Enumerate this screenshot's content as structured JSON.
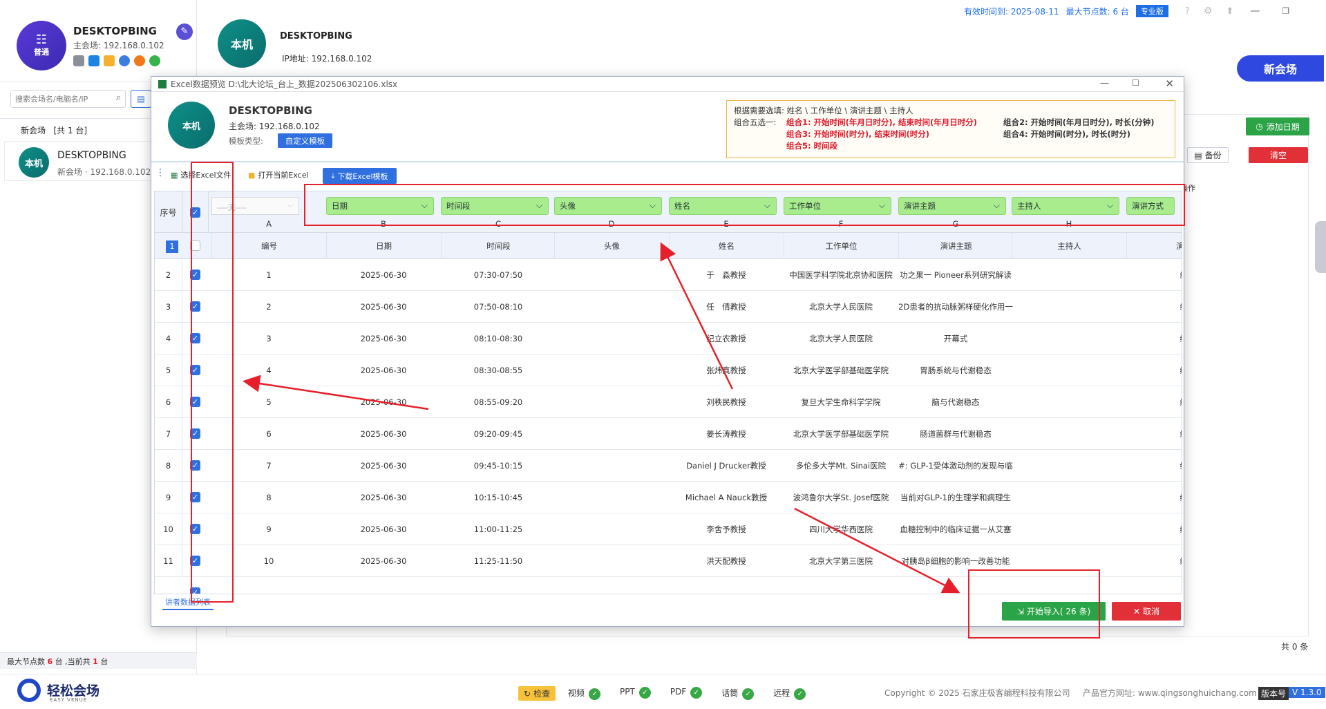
{
  "topbar": {
    "validity": "有效时间到: 2025-08-11",
    "max_nodes": "最大节点数: 6 台",
    "edition": "专业版"
  },
  "sidebar": {
    "host_badge": "普通",
    "host_name": "DESKTOPBING",
    "host_ip": "主会场: 192.168.0.102",
    "search_placeholder": "搜索会场名/电脑名/IP",
    "group_title": "新会场",
    "group_count": "[共 1 台]",
    "device_avatar": "本机",
    "device_name": "DESKTOPBING",
    "device_sub": "新会场 · 192.168.0.102",
    "footer": {
      "prefix": "最大节点数",
      "max": "6",
      "mid": "台 ,当前共",
      "cur": "1",
      "suffix": "台"
    }
  },
  "main": {
    "avatar": "本机",
    "name": "DESKTOPBING",
    "ip": "IP地址: 192.168.0.102",
    "new_venue": "新会场",
    "add_date": "添加日期",
    "backup": "备份",
    "clear": "清空",
    "op_col": "操作",
    "total": "共 0 条"
  },
  "dialog": {
    "title": "Excel数据预览 D:\\北大论坛_台上_数据202506302106.xlsx",
    "avatar": "本机",
    "name": "DESKTOPBING",
    "ip": "主会场: 192.168.0.102",
    "template_label": "模板类型:",
    "template_value": "自定义模板",
    "info": {
      "line1": "根据需要选填: 姓名 \\ 工作单位 \\ 演讲主题 \\ 主持人",
      "prefix": "组合五选一:",
      "c1": "组合1: 开始时间(年月日时分), 结束时间(年月日时分)",
      "c2": "组合2: 开始时间(年月日时分), 时长(分钟)",
      "c3": "组合3: 开始时间(时分), 结束时间(时分)",
      "c4": "组合4: 开始时间(时分), 时长(时分)",
      "c5": "组合5: 时间段"
    },
    "toolbar": {
      "select_excel": "选择Excel文件",
      "open_excel": "打开当前Excel",
      "download": "下载Excel模板"
    },
    "grid": {
      "row_header": "序号",
      "first_select": "----无----",
      "letters": [
        "A",
        "B",
        "C",
        "D",
        "E",
        "F",
        "G",
        "H"
      ],
      "mappings": [
        "日期",
        "时间段",
        "头像",
        "姓名",
        "工作单位",
        "演讲主题",
        "主持人",
        "演讲方式"
      ],
      "headers": [
        "编号",
        "日期",
        "时间段",
        "头像",
        "姓名",
        "工作单位",
        "演讲主题",
        "主持人",
        "演讲"
      ],
      "rows": [
        {
          "n": "2",
          "c": [
            "1",
            "2025-06-30",
            "07:30-07:50",
            "",
            "于　淼教授",
            "中国医学科学院北京协和医院",
            "功之果一 Pioneer系列研究解读",
            "",
            "线"
          ]
        },
        {
          "n": "3",
          "c": [
            "2",
            "2025-06-30",
            "07:50-08:10",
            "",
            "任　倩教授",
            "北京大学人民医院",
            "2D患者的抗动脉粥样硬化作用一",
            "",
            "线"
          ]
        },
        {
          "n": "4",
          "c": [
            "3",
            "2025-06-30",
            "08:10-08:30",
            "",
            "纪立农教授",
            "北京大学人民医院",
            "开幕式",
            "",
            "线"
          ]
        },
        {
          "n": "5",
          "c": [
            "4",
            "2025-06-30",
            "08:30-08:55",
            "",
            "张炜真教授",
            "北京大学医学部基础医学院",
            "胃肠系统与代谢稳态",
            "",
            "线"
          ]
        },
        {
          "n": "6",
          "c": [
            "5",
            "2025-06-30",
            "08:55-09:20",
            "",
            "刘秩民教授",
            "复旦大学生命科学学院",
            "脑与代谢稳态",
            "",
            "线"
          ]
        },
        {
          "n": "7",
          "c": [
            "6",
            "2025-06-30",
            "09:20-09:45",
            "",
            "姜长涛教授",
            "北京大学医学部基础医学院",
            "肠道菌群与代谢稳态",
            "",
            "线"
          ]
        },
        {
          "n": "8",
          "c": [
            "7",
            "2025-06-30",
            "09:45-10:15",
            "",
            "Daniel J Drucker教授",
            "多伦多大学Mt. Sinai医院",
            "#: GLP-1受体激动剂的发现与临",
            "",
            "线"
          ]
        },
        {
          "n": "9",
          "c": [
            "8",
            "2025-06-30",
            "10:15-10:45",
            "",
            "Michael A Nauck教授",
            "波鸿鲁尔大学St. Josef医院",
            "当前对GLP-1的生理学和病理生",
            "",
            "线"
          ]
        },
        {
          "n": "10",
          "c": [
            "9",
            "2025-06-30",
            "11:00-11:25",
            "",
            "李舍予教授",
            "四川大学华西医院",
            "血糖控制中的临床证据一从艾塞",
            "",
            "线"
          ]
        },
        {
          "n": "11",
          "c": [
            "10",
            "2025-06-30",
            "11:25-11:50",
            "",
            "洪天配教授",
            "北京大学第三医院",
            "对胰岛β细胞的影响一改善功能",
            "",
            "线"
          ]
        }
      ]
    },
    "sheet_tab": "讲者数据列表",
    "import_btn": "开始导入( 26 条)",
    "cancel_btn": "取消"
  },
  "bottom": {
    "check": "检查",
    "items": [
      "视频",
      "PPT",
      "PDF",
      "话筒",
      "远程"
    ],
    "copyright": "Copyright © 2025 石家庄极客编程科技有限公司",
    "website": "产品官方网址: www.qingsonghuichang.com",
    "version_label": "版本号",
    "version": "V 1.3.0",
    "logo_main": "轻松会场",
    "logo_sub": "EASY VENUE"
  }
}
